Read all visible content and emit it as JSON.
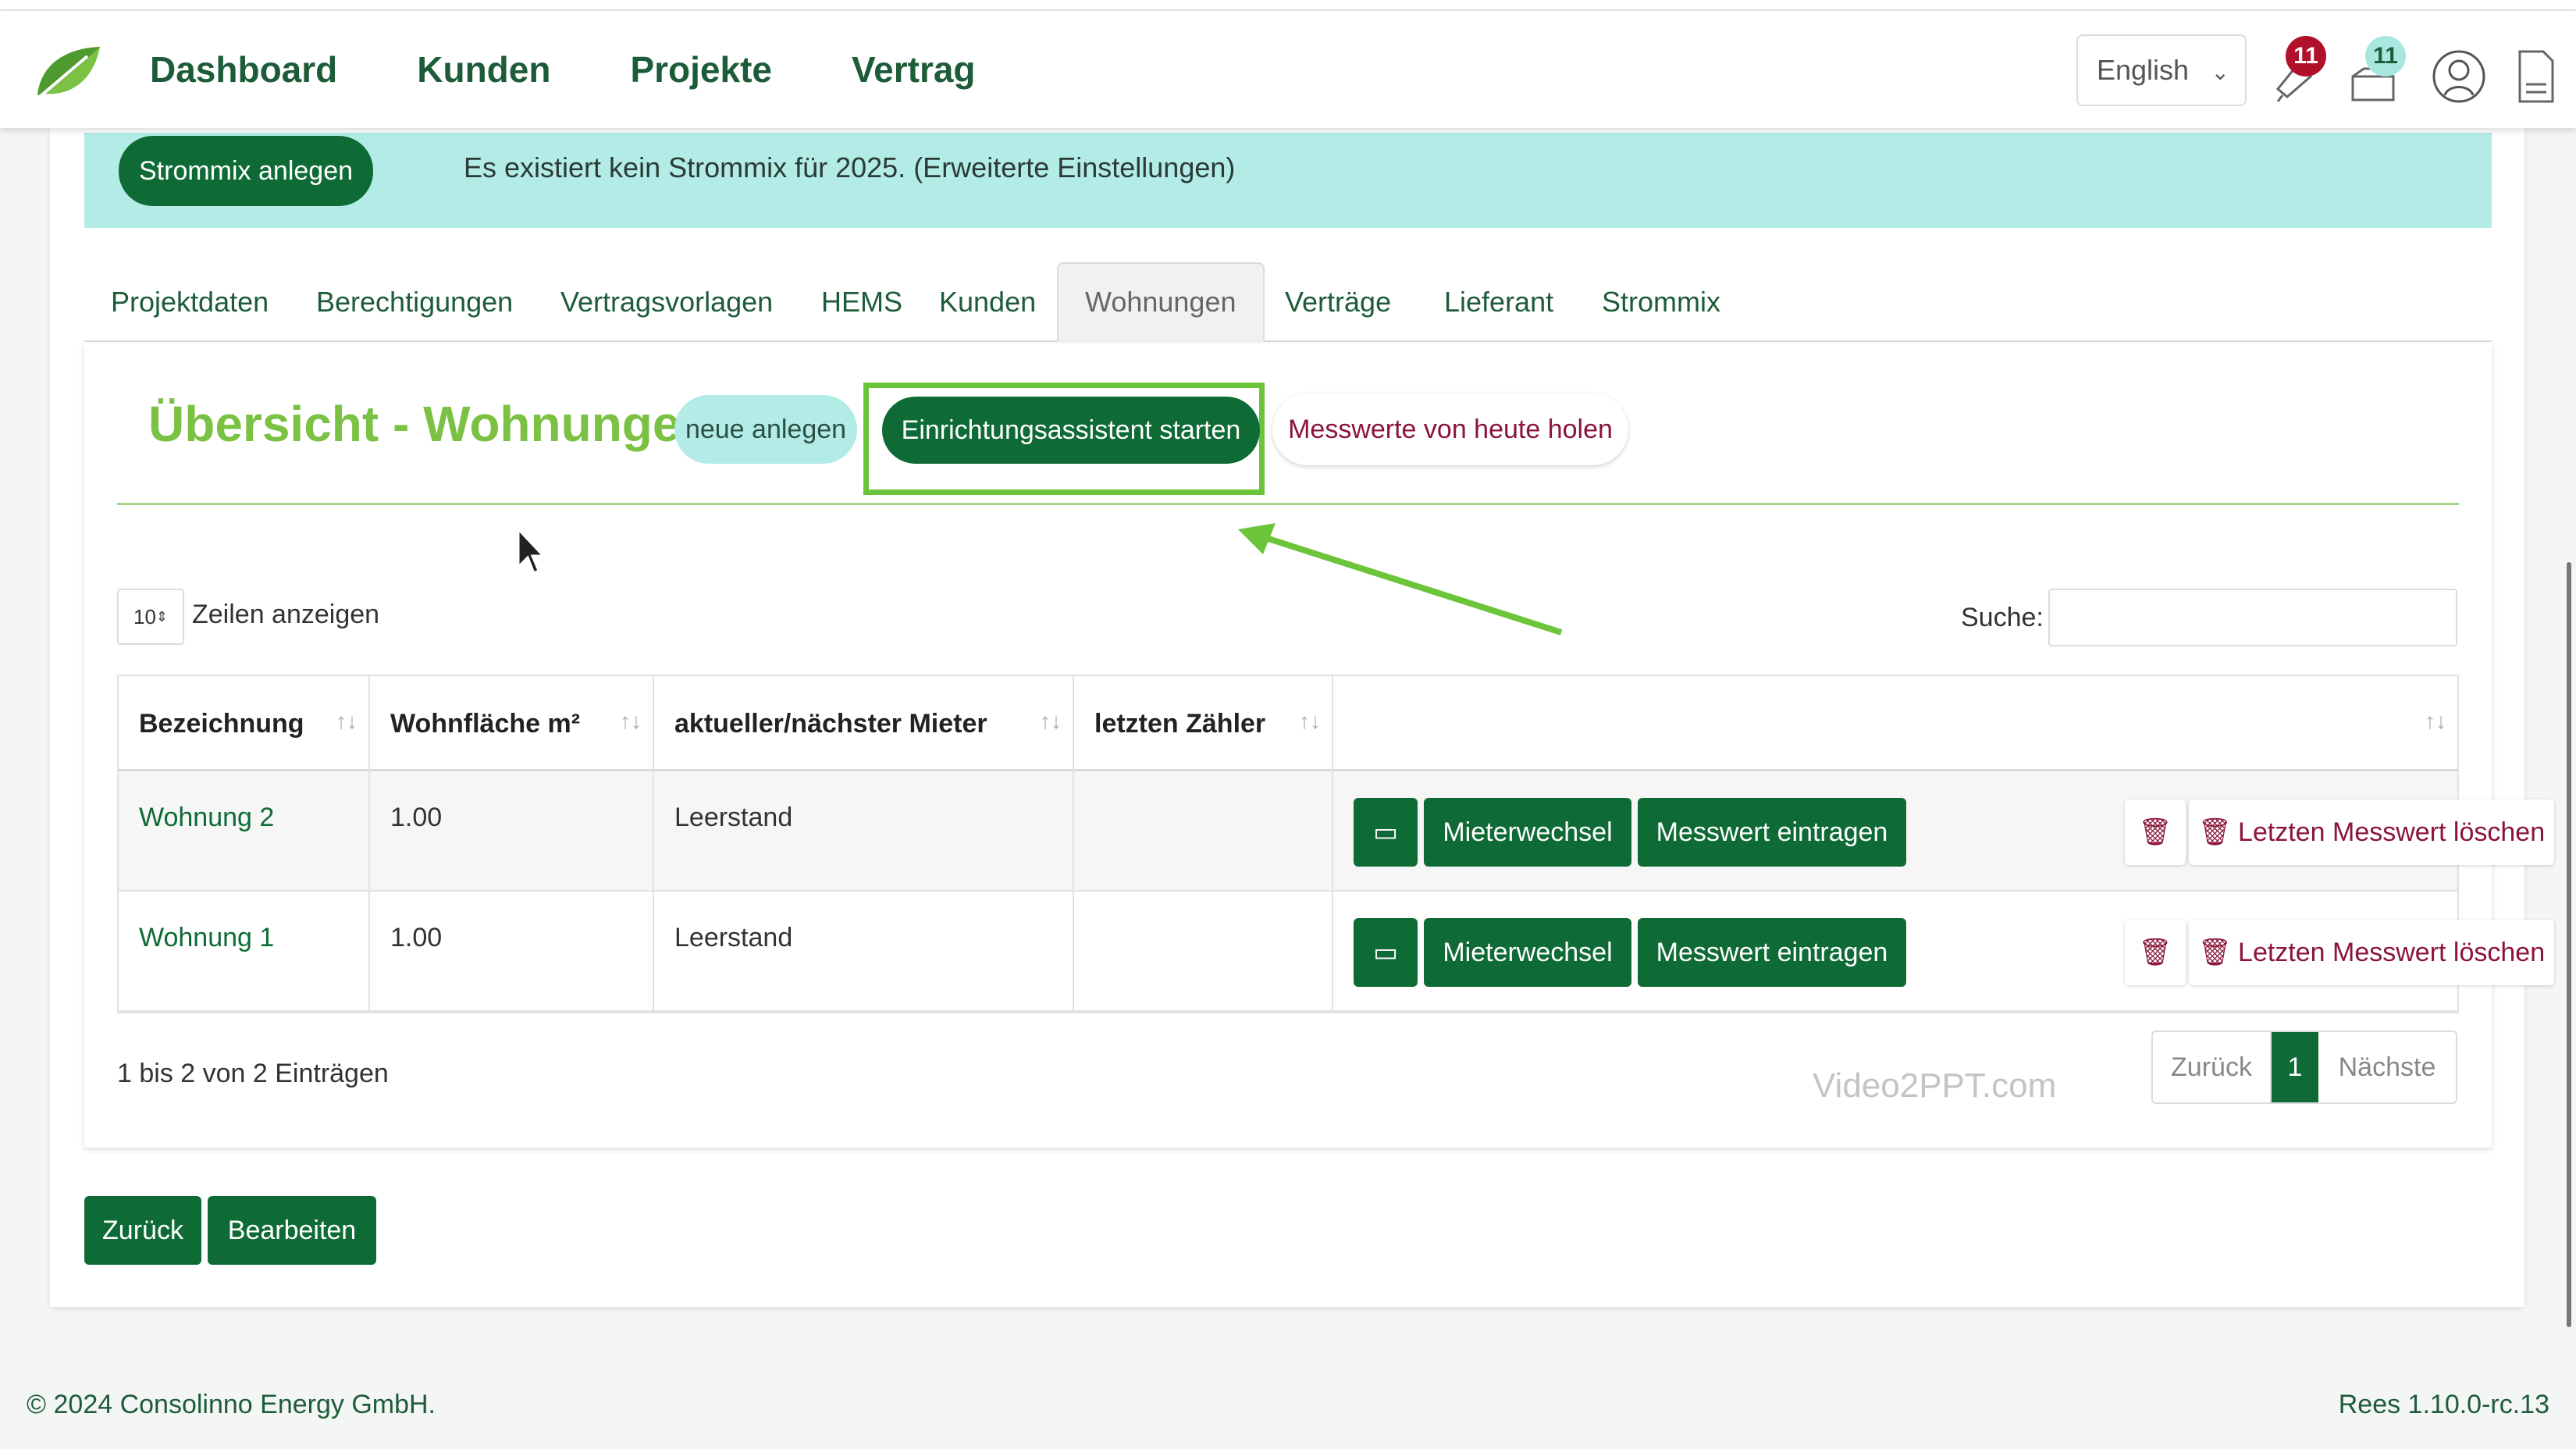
{
  "nav": {
    "items": [
      "Dashboard",
      "Kunden",
      "Projekte",
      "Vertrag"
    ],
    "language": "English",
    "notifications_count": "11",
    "messages_count": "11"
  },
  "alert": {
    "button": "Strommix anlegen",
    "text": "Es existiert kein Strommix für 2025. (Erweiterte Einstellungen)"
  },
  "tabs": [
    "Projektdaten",
    "Berechtigungen",
    "Vertragsvorlagen",
    "HEMS",
    "Kunden",
    "Wohnungen",
    "Verträge",
    "Lieferant",
    "Strommix"
  ],
  "active_tab": "Wohnungen",
  "overview": {
    "title": "Übersicht - Wohnungen",
    "new_button": "neue anlegen",
    "assistant_button": "Einrichtungsassistent starten",
    "measure_button": "Messwerte von heute holen"
  },
  "table_controls": {
    "length_value": "10",
    "length_label": "Zeilen anzeigen",
    "search_label": "Suche:",
    "search_value": ""
  },
  "table": {
    "columns": [
      "Bezeichnung",
      "Wohnfläche m²",
      "aktueller/nächster Mieter",
      "letzten Zähler",
      ""
    ],
    "rows": [
      {
        "name": "Wohnung 2",
        "area": "1.00",
        "tenant": "Leerstand",
        "meter": ""
      },
      {
        "name": "Wohnung 1",
        "area": "1.00",
        "tenant": "Leerstand",
        "meter": ""
      }
    ],
    "row_actions": {
      "tenant_change": "Mieterwechsel",
      "enter_value": "Messwert eintragen",
      "delete_last": "Letzten Messwert löschen"
    }
  },
  "pagination": {
    "info": "1 bis 2 von 2 Einträgen",
    "prev": "Zurück",
    "current": "1",
    "next": "Nächste"
  },
  "watermark": "Video2PPT.com",
  "bottom_buttons": {
    "back": "Zurück",
    "edit": "Bearbeiten"
  },
  "footer": {
    "copyright": "© 2024 Consolinno Energy GmbH.",
    "version": "Rees 1.10.0-rc.13"
  },
  "colors": {
    "brand_dark_green": "#0f6b35",
    "brand_light_green": "#7bc143",
    "alert_bg": "#b3ece6",
    "highlight_box": "#6cc43a",
    "danger_text": "#8a1538"
  }
}
